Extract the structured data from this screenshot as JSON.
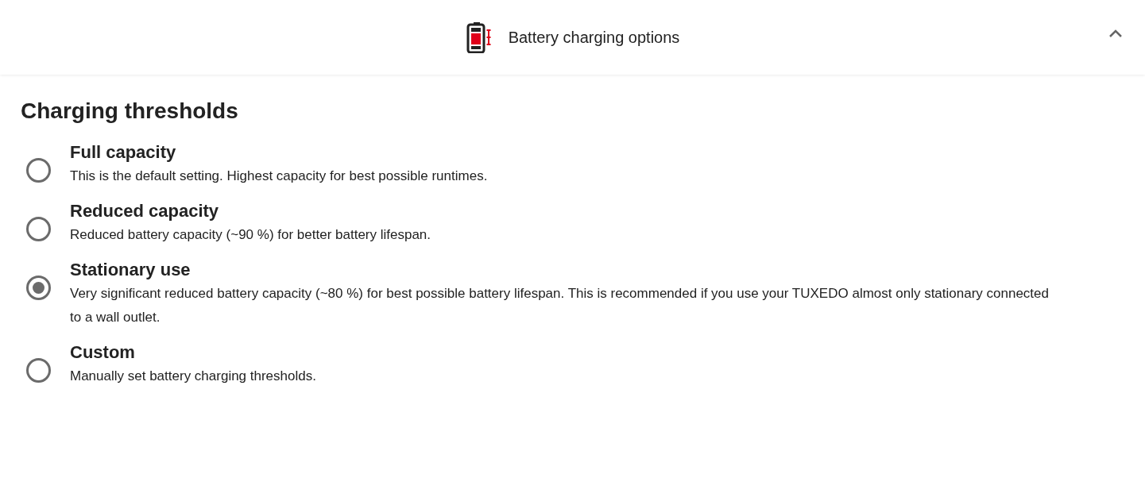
{
  "header": {
    "title": "Battery charging options",
    "expanded": true
  },
  "section": {
    "title": "Charging thresholds"
  },
  "options": [
    {
      "title": "Full capacity",
      "description": "This is the default setting. Highest capacity for best possible runtimes.",
      "selected": false
    },
    {
      "title": "Reduced capacity",
      "description": "Reduced battery capacity (~90 %) for better battery lifespan.",
      "selected": false
    },
    {
      "title": "Stationary use",
      "description": "Very significant reduced battery capacity (~80 %) for best possible battery lifespan. This is recommended if you use your TUXEDO almost only stationary connected to a wall outlet.",
      "selected": true
    },
    {
      "title": "Custom",
      "description": "Manually set battery charging thresholds.",
      "selected": false
    }
  ]
}
